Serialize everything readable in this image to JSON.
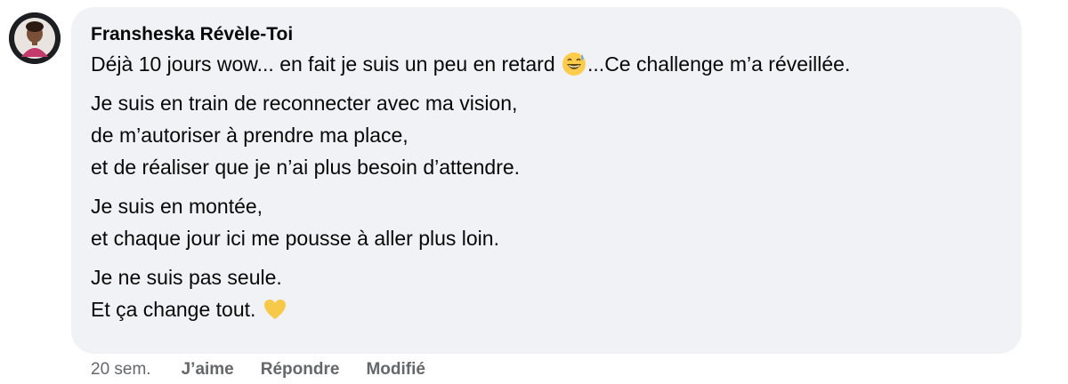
{
  "comment": {
    "author": "Fransheska Révèle-Toi",
    "line1_before": "Déjà 10 jours wow... en fait je suis un peu en retard ",
    "line1_emoji": "grinning-sweat-emoji",
    "line1_after": "...Ce challenge m’a réveillée.",
    "para2": [
      "Je suis en train de reconnecter avec ma vision,",
      "de m’autoriser à prendre ma place,",
      "et de réaliser que je n’ai plus besoin d’attendre."
    ],
    "para3": [
      "Je suis en montée,",
      "et chaque jour ici me pousse à aller plus loin."
    ],
    "para4_line1": "Je ne suis pas seule.",
    "para4_line2": "Et ça change tout. ",
    "para4_emoji": "yellow-heart-emoji"
  },
  "actions": {
    "time": "20 sem.",
    "like": "J’aime",
    "reply": "Répondre",
    "edited": "Modifié"
  },
  "colors": {
    "bubble": "#f0f2f5",
    "text": "#080809",
    "secondary": "#65676b",
    "heart": "#f7c948"
  }
}
